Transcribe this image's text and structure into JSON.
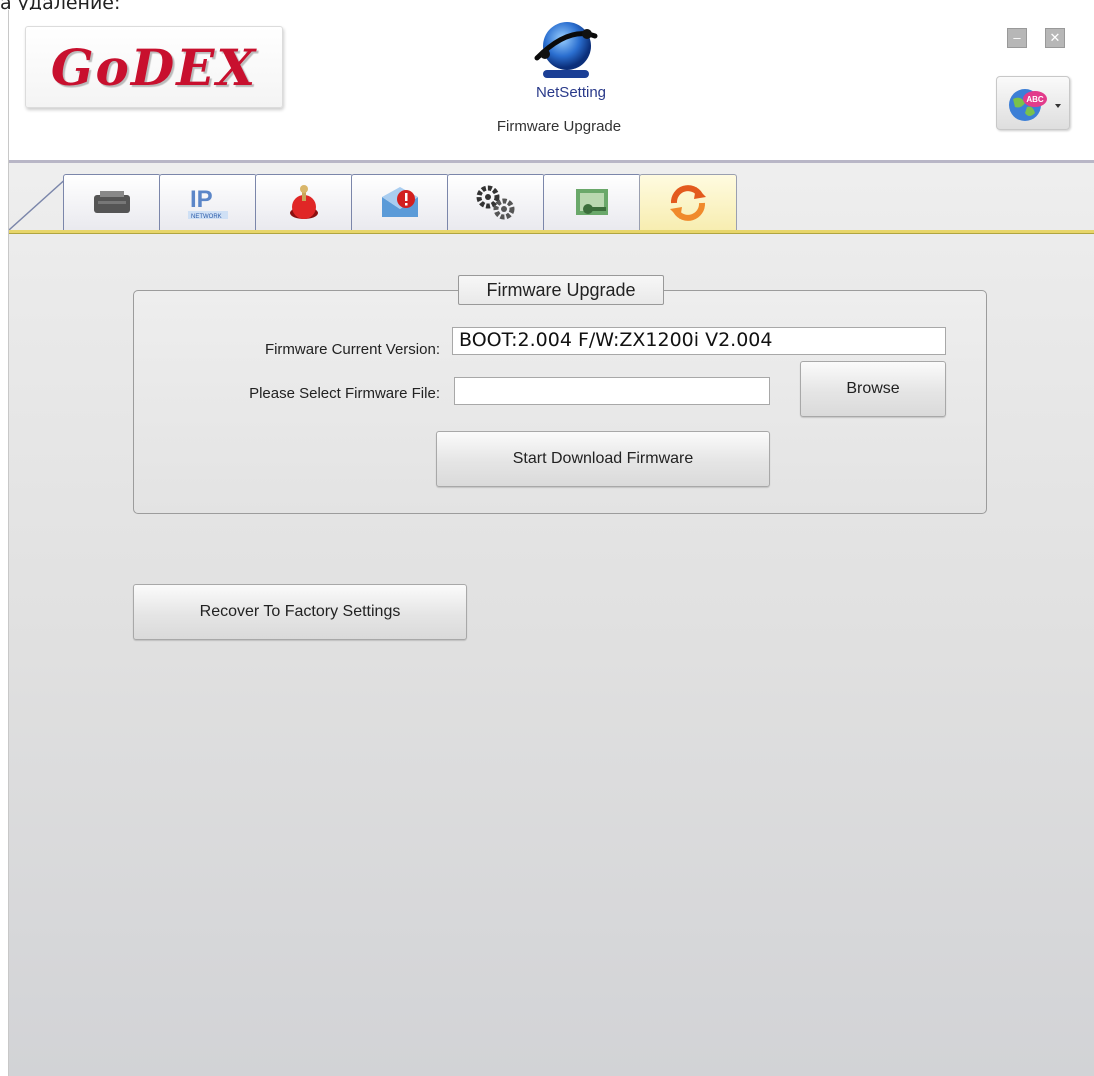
{
  "caption": "а удаление:",
  "header": {
    "logo_text": "GoDEX",
    "app_name": "NetSetting",
    "subtitle": "Firmware Upgrade",
    "window_controls": {
      "minimize": "–",
      "close": "✕"
    },
    "language_button_icon": "globe-abc-icon"
  },
  "tabs": [
    {
      "icon": "printer-icon",
      "active": false
    },
    {
      "icon": "ip-network-icon",
      "active": false
    },
    {
      "icon": "alarm-button-icon",
      "active": false
    },
    {
      "icon": "mail-alert-icon",
      "active": false
    },
    {
      "icon": "gears-icon",
      "active": false
    },
    {
      "icon": "key-icon",
      "active": false
    },
    {
      "icon": "refresh-arrows-icon",
      "active": true
    }
  ],
  "firmware_group": {
    "title": "Firmware Upgrade",
    "current_version_label": "Firmware Current Version:",
    "current_version_value": "BOOT:2.004 F/W:ZX1200i V2.004",
    "select_file_label": "Please Select Firmware File:",
    "select_file_value": "",
    "browse_label": "Browse",
    "start_label": "Start Download Firmware"
  },
  "recover_label": "Recover To Factory  Settings",
  "colors": {
    "accent_yellow": "#e7d56a",
    "tab_border": "#7b86aa",
    "logo_red": "#c8102e"
  }
}
